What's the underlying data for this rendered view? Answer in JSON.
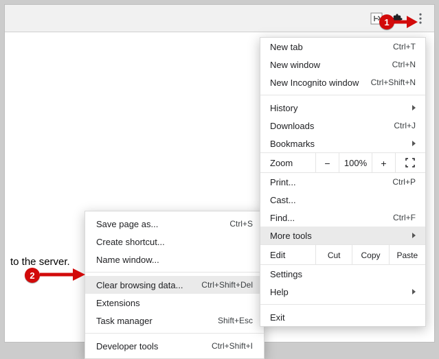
{
  "page": {
    "visible_text": "to the server."
  },
  "toolbar": {
    "hubspot_badge": "HubSpot",
    "extensions_icon": "Extensions",
    "menu_button": "Customize and control"
  },
  "main_menu": {
    "new_tab": {
      "label": "New tab",
      "shortcut": "Ctrl+T"
    },
    "new_window": {
      "label": "New window",
      "shortcut": "Ctrl+N"
    },
    "new_incognito": {
      "label": "New Incognito window",
      "shortcut": "Ctrl+Shift+N"
    },
    "history": {
      "label": "History"
    },
    "downloads": {
      "label": "Downloads",
      "shortcut": "Ctrl+J"
    },
    "bookmarks": {
      "label": "Bookmarks"
    },
    "zoom": {
      "label": "Zoom",
      "minus": "−",
      "value": "100%",
      "plus": "+"
    },
    "print": {
      "label": "Print...",
      "shortcut": "Ctrl+P"
    },
    "cast": {
      "label": "Cast..."
    },
    "find": {
      "label": "Find...",
      "shortcut": "Ctrl+F"
    },
    "more_tools": {
      "label": "More tools"
    },
    "edit": {
      "label": "Edit",
      "cut": "Cut",
      "copy": "Copy",
      "paste": "Paste"
    },
    "settings": {
      "label": "Settings"
    },
    "help": {
      "label": "Help"
    },
    "exit": {
      "label": "Exit"
    }
  },
  "submenu": {
    "save_page": {
      "label": "Save page as...",
      "shortcut": "Ctrl+S"
    },
    "create_shortcut": {
      "label": "Create shortcut..."
    },
    "name_window": {
      "label": "Name window..."
    },
    "clear_browsing": {
      "label": "Clear browsing data...",
      "shortcut": "Ctrl+Shift+Del"
    },
    "extensions": {
      "label": "Extensions"
    },
    "task_manager": {
      "label": "Task manager",
      "shortcut": "Shift+Esc"
    },
    "developer_tools": {
      "label": "Developer tools",
      "shortcut": "Ctrl+Shift+I"
    }
  },
  "annotations": {
    "step1": "1",
    "step2": "2"
  }
}
